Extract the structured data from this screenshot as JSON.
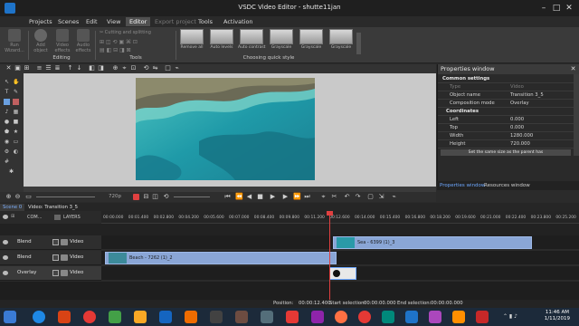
{
  "window": {
    "title": "VSDC Video Editor - shutte11jan"
  },
  "menu": [
    {
      "label": "Projects"
    },
    {
      "label": "Scenes"
    },
    {
      "label": "Edit"
    },
    {
      "label": "View"
    },
    {
      "label": "Editor",
      "active": true
    },
    {
      "label": "Export project",
      "dim": true
    },
    {
      "label": "Tools"
    },
    {
      "label": "Activation"
    }
  ],
  "ribbon": {
    "run_wizard": "Run Wizard...",
    "add_object": "Add object",
    "video_effects": "Video effects",
    "audio_effects": "Audio effects",
    "cutting_label": "Cutting and splitting",
    "editing_label": "Editing",
    "tools_label": "Tools",
    "quick_style_label": "Choosing quick style",
    "quick_styles": [
      "Remove all",
      "Auto levels",
      "Auto contrast",
      "Grayscale",
      "Grayscale",
      "Grayscale"
    ]
  },
  "properties": {
    "title": "Properties window",
    "sections": {
      "common": "Common settings",
      "coordinates": "Coordinates"
    },
    "rows": {
      "type": {
        "key": "Type",
        "value": "Video"
      },
      "object_name": {
        "key": "Object name",
        "value": "Transition 3_5"
      },
      "composition": {
        "key": "Composition mode",
        "value": "Overlay"
      },
      "left": {
        "key": "Left",
        "value": "0.000"
      },
      "top": {
        "key": "Top",
        "value": "0.000"
      },
      "width": {
        "key": "Width",
        "value": "1280.000"
      },
      "height": {
        "key": "Height",
        "value": "720.000"
      }
    },
    "hint": "Set the same size as the parent has",
    "tabs": {
      "properties": "Properties window",
      "resources": "Resources window"
    }
  },
  "playback": {
    "quality": "720p"
  },
  "timeline": {
    "tabs": {
      "scene": "Scene 0",
      "path": "Video: Transition 3_5"
    },
    "layers_header": {
      "com": "COM...",
      "layers": "LAYERS"
    },
    "ruler_ticks": [
      "00:00.000",
      "00:01.400",
      "00:02.800",
      "00:04.200",
      "00:05.600",
      "00:07.000",
      "00:08.400",
      "00:09.800",
      "00:11.200",
      "00:12.600",
      "00:14.000",
      "00:15.400",
      "00:16.800",
      "00:18.200",
      "00:19.600",
      "00:21.000",
      "00:22.400",
      "00:23.800",
      "00:25.200"
    ],
    "tracks": [
      {
        "mode": "Blend",
        "type": "Video",
        "clip": "Sea - 6399 (1)_3"
      },
      {
        "mode": "Blend",
        "type": "Video",
        "clip": "Beach - 7262 (1)_2"
      },
      {
        "mode": "Overlay",
        "type": "Video",
        "clip": ""
      }
    ]
  },
  "status": {
    "position_label": "Position:",
    "position": "00:00:12.400",
    "start_label": "Start selection:",
    "start": "00:00:00.000",
    "end_label": "End selection:",
    "end": "00:00:00.000"
  },
  "taskbar": {
    "time": "11:46 AM",
    "date": "1/11/2019"
  },
  "colors": {
    "accent": "#1e73c8",
    "clip": "#8aa6d6",
    "playhead": "#e04040"
  }
}
